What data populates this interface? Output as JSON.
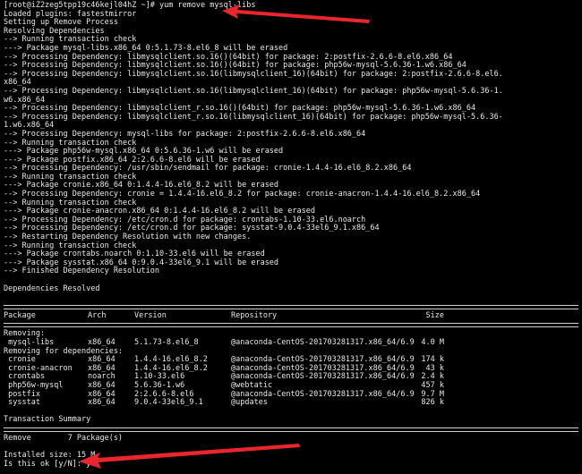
{
  "terminal": {
    "lines_top": [
      "[root@iZ2zeg5tpp19c46kejl04hZ ~]# yum remove mysql-libs",
      "Loaded plugins: fastestmirror",
      "Setting up Remove Process",
      "Resolving Dependencies",
      "--> Running transaction check",
      "---> Package mysql-libs.x86_64 0:5.1.73-8.el6_8 will be erased",
      "--> Processing Dependency: libmysqlclient.so.16()(64bit) for package: 2:postfix-2.6.6-8.el6.x86_64",
      "--> Processing Dependency: libmysqlclient.so.16()(64bit) for package: php56w-mysql-5.6.36-1.w6.x86_64",
      "--> Processing Dependency: libmysqlclient.so.16(libmysqlclient_16)(64bit) for package: 2:postfix-2.6.6-8.el6.",
      "x86_64",
      "--> Processing Dependency: libmysqlclient.so.16(libmysqlclient_16)(64bit) for package: php56w-mysql-5.6.36-1.",
      "w6.x86_64",
      "--> Processing Dependency: libmysqlclient_r.so.16()(64bit) for package: php56w-mysql-5.6.36-1.w6.x86_64",
      "--> Processing Dependency: libmysqlclient_r.so.16(libmysqlclient_16)(64bit) for package: php56w-mysql-5.6.36-",
      "1.w6.x86_64",
      "--> Processing Dependency: mysql-libs for package: 2:postfix-2.6.6-8.el6.x86_64",
      "--> Running transaction check",
      "---> Package php56w-mysql.x86_64 0:5.6.36-1.w6 will be erased",
      "---> Package postfix.x86_64 2:2.6.6-8.el6 will be erased",
      "--> Processing Dependency: /usr/sbin/sendmail for package: cronie-1.4.4-16.el6_8.2.x86_64",
      "--> Running transaction check",
      "---> Package cronie.x86_64 0:1.4.4-16.el6_8.2 will be erased",
      "--> Processing Dependency: cronie = 1.4.4-16.el6_8.2 for package: cronie-anacron-1.4.4-16.el6_8.2.x86_64",
      "--> Running transaction check",
      "---> Package cronie-anacron.x86_64 0:1.4.4-16.el6_8.2 will be erased",
      "--> Processing Dependency: /etc/cron.d for package: crontabs-1.10-33.el6.noarch",
      "--> Processing Dependency: /etc/cron.d for package: sysstat-9.0.4-33el6_9.1.x86_64",
      "--> Restarting Dependency Resolution with new changes.",
      "--> Running transaction check",
      "---> Package crontabs.noarch 0:1.10-33.el6 will be erased",
      "---> Package sysstat.x86_64 0:9.0.4-33el6_9.1 will be erased",
      "--> Finished Dependency Resolution",
      "",
      "Dependencies Resolved"
    ],
    "table": {
      "headers": [
        "Package",
        "Arch",
        "Version",
        "Repository",
        "Size"
      ],
      "removing_label": "Removing:",
      "removing_rows": [
        [
          " mysql-libs",
          "x86_64",
          "5.1.73-8.el6_8",
          "@anaconda-CentOS-201703281317.x86_64/6.9",
          "4.0 M"
        ]
      ],
      "deps_label": "Removing for dependencies:",
      "deps_rows": [
        [
          " cronie",
          "x86_64",
          "1.4.4-16.el6_8.2",
          "@anaconda-CentOS-201703281317.x86_64/6.9",
          "174 k"
        ],
        [
          " cronie-anacron",
          "x86_64",
          "1.4.4-16.el6_8.2",
          "@anaconda-CentOS-201703281317.x86_64/6.9",
          "43 k"
        ],
        [
          " crontabs",
          "noarch",
          "1.10-33.el6",
          "@anaconda-CentOS-201703281317.x86_64/6.9",
          "2.4 k"
        ],
        [
          " php56w-mysql",
          "x86_64",
          "5.6.36-1.w6",
          "@webtatic",
          "457 k"
        ],
        [
          " postfix",
          "x86_64",
          "2:2.6.6-8.el6",
          "@anaconda-CentOS-201703281317.x86_64/6.9",
          "9.7 M"
        ],
        [
          " sysstat",
          "x86_64",
          "9.0.4-33el6_9.1",
          "@updates",
          "826 k"
        ]
      ]
    },
    "summary_title": "Transaction Summary",
    "summary_line": "Remove        7 Package(s)",
    "installed_size": "Installed size: 15 M",
    "prompt": "Is this ok [y/N]: y"
  },
  "colors": {
    "background": "#000000",
    "text": "#e8e8e8",
    "annotation_arrow": "#e8262b"
  },
  "annotations": {
    "arrow_top": "red-arrow-icon",
    "arrow_bottom": "red-arrow-icon"
  }
}
